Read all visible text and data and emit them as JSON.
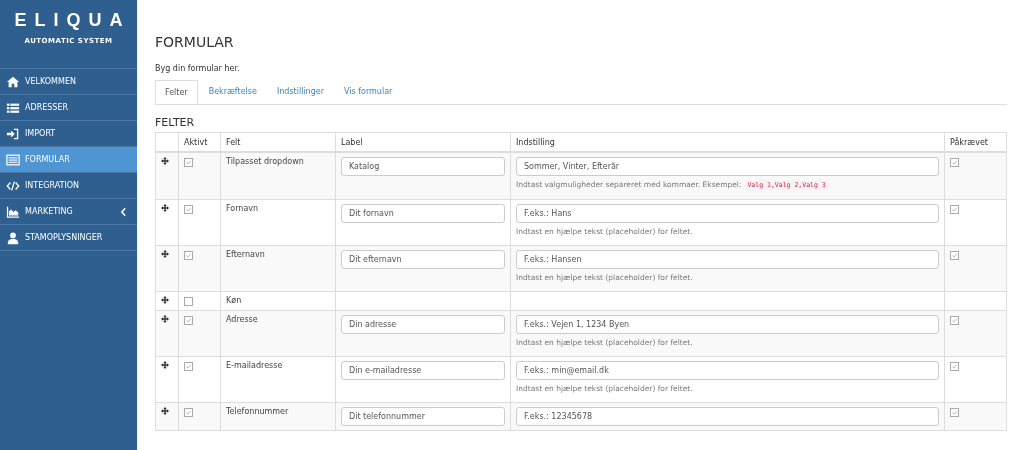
{
  "brand": {
    "name": "ELIQUA",
    "tagline": "AUTOMATIC SYSTEM"
  },
  "sidebar": {
    "items": [
      {
        "label": "VELKOMMEN",
        "selected": false,
        "expandable": false
      },
      {
        "label": "ADRESSER",
        "selected": false,
        "expandable": false
      },
      {
        "label": "IMPORT",
        "selected": false,
        "expandable": false
      },
      {
        "label": "FORMULAR",
        "selected": true,
        "expandable": false
      },
      {
        "label": "INTEGRATION",
        "selected": false,
        "expandable": false
      },
      {
        "label": "MARKETING",
        "selected": false,
        "expandable": true
      },
      {
        "label": "STAMOPLYSNINGER",
        "selected": false,
        "expandable": false
      }
    ]
  },
  "page": {
    "title": "FORMULAR",
    "intro": "Byg din formular her."
  },
  "tabs": [
    {
      "label": "Felter",
      "selected": true
    },
    {
      "label": "Bekræftelse",
      "selected": false
    },
    {
      "label": "Indstillinger",
      "selected": false
    },
    {
      "label": "Vis formular",
      "selected": false
    }
  ],
  "section_title": "FELTER",
  "table": {
    "columns": [
      "Aktivt",
      "Felt",
      "Label",
      "Indstilling",
      "Påkrævet"
    ],
    "rows": [
      {
        "active": true,
        "field": "Tilpasset dropdown",
        "label": "Katalog",
        "setting": "Sommer, Vinter, Efterår",
        "hint": "Indtast valgmuligheder separeret med kommaer. Eksempel:",
        "example": "Valg 1,Valg 2,Valg 3",
        "required": true
      },
      {
        "active": true,
        "field": "Fornavn",
        "label": "Dit fornavn",
        "setting": "F.eks.: Hans",
        "hint": "Indtast en hjælpe tekst (placeholder) for feltet.",
        "required": true
      },
      {
        "active": true,
        "field": "Efternavn",
        "label": "Dit efternavn",
        "setting": "F.eks.: Hansen",
        "hint": "Indtast en hjælpe tekst (placeholder) for feltet.",
        "required": true
      },
      {
        "active": false,
        "field": "Køn"
      },
      {
        "active": true,
        "field": "Adresse",
        "label": "Din adresse",
        "setting": "F.eks.: Vejen 1, 1234 Byen",
        "hint": "Indtast en hjælpe tekst (placeholder) for feltet.",
        "required": true
      },
      {
        "active": true,
        "field": "E-mailadresse",
        "label": "Din e-mailadresse",
        "setting": "F.eks.: min@email.dk",
        "hint": "Indtast en hjælpe tekst (placeholder) for feltet.",
        "required": true
      },
      {
        "active": true,
        "field": "Telefonnummer",
        "label": "Dit telefonnummer",
        "setting": "F.eks.: 12345678",
        "required": true
      }
    ]
  }
}
